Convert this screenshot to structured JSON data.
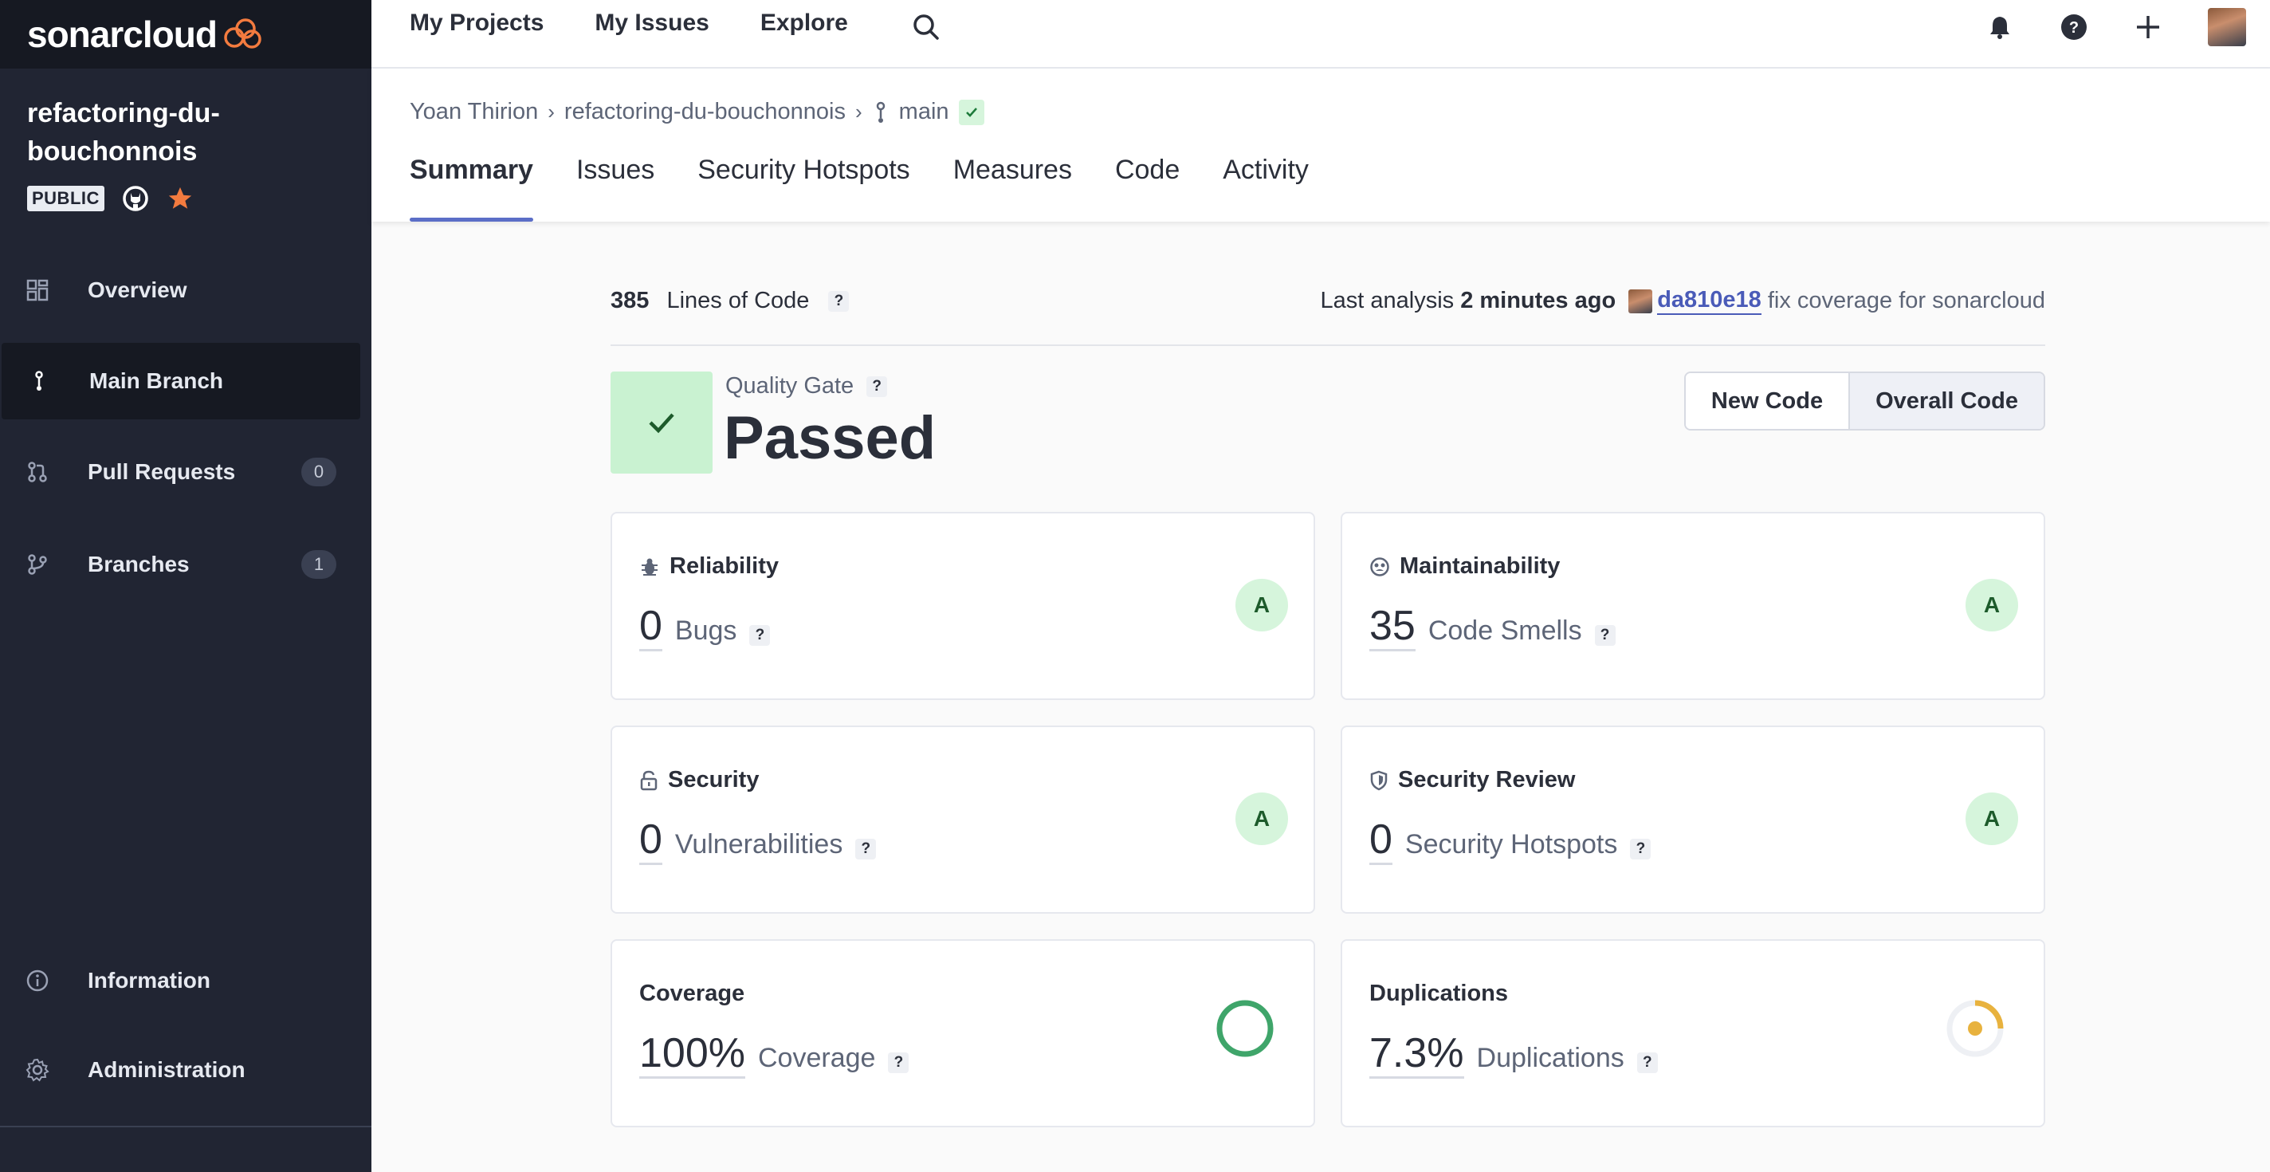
{
  "sidebar": {
    "logo": "sonarcloud",
    "project_name": "refactoring-du-bouchonnois",
    "visibility": "PUBLIC",
    "nav": [
      {
        "label": "Overview",
        "icon": "overview-icon"
      },
      {
        "label": "Main Branch",
        "icon": "branch-icon"
      },
      {
        "label": "Pull Requests",
        "icon": "pull-request-icon",
        "count": "0"
      },
      {
        "label": "Branches",
        "icon": "branches-icon",
        "count": "1"
      }
    ],
    "bottom_nav": [
      {
        "label": "Information",
        "icon": "info-icon"
      },
      {
        "label": "Administration",
        "icon": "gear-icon"
      }
    ]
  },
  "topbar": {
    "links": [
      "My Projects",
      "My Issues",
      "Explore"
    ]
  },
  "breadcrumb": {
    "org": "Yoan Thirion",
    "project": "refactoring-du-bouchonnois",
    "branch": "main"
  },
  "tabs": [
    "Summary",
    "Issues",
    "Security Hotspots",
    "Measures",
    "Code",
    "Activity"
  ],
  "summary": {
    "loc_value": "385",
    "loc_label": "Lines of Code",
    "last_analysis_label": "Last analysis",
    "last_analysis_time": "2 minutes ago",
    "commit_hash": "da810e18",
    "commit_message": "fix coverage for sonarcloud",
    "quality_gate_label": "Quality Gate",
    "quality_gate_status": "Passed",
    "toggle": {
      "new": "New Code",
      "overall": "Overall Code"
    }
  },
  "cards": {
    "reliability": {
      "title": "Reliability",
      "value": "0",
      "unit": "Bugs",
      "grade": "A"
    },
    "maintainability": {
      "title": "Maintainability",
      "value": "35",
      "unit": "Code Smells",
      "grade": "A"
    },
    "security": {
      "title": "Security",
      "value": "0",
      "unit": "Vulnerabilities",
      "grade": "A"
    },
    "security_review": {
      "title": "Security Review",
      "value": "0",
      "unit": "Security Hotspots",
      "grade": "A"
    },
    "coverage": {
      "title": "Coverage",
      "value": "100%",
      "unit": "Coverage",
      "fraction": 1.0
    },
    "duplications": {
      "title": "Duplications",
      "value": "7.3%",
      "unit": "Duplications",
      "fraction": 0.073
    }
  },
  "colors": {
    "sidebar_bg": "#212533",
    "accent": "#5b6ec7",
    "passed_bg": "#c9f2d1",
    "grade_a": "#d6f5dc",
    "coverage_ring": "#3fa56a",
    "duplication": "#e8b23e"
  }
}
